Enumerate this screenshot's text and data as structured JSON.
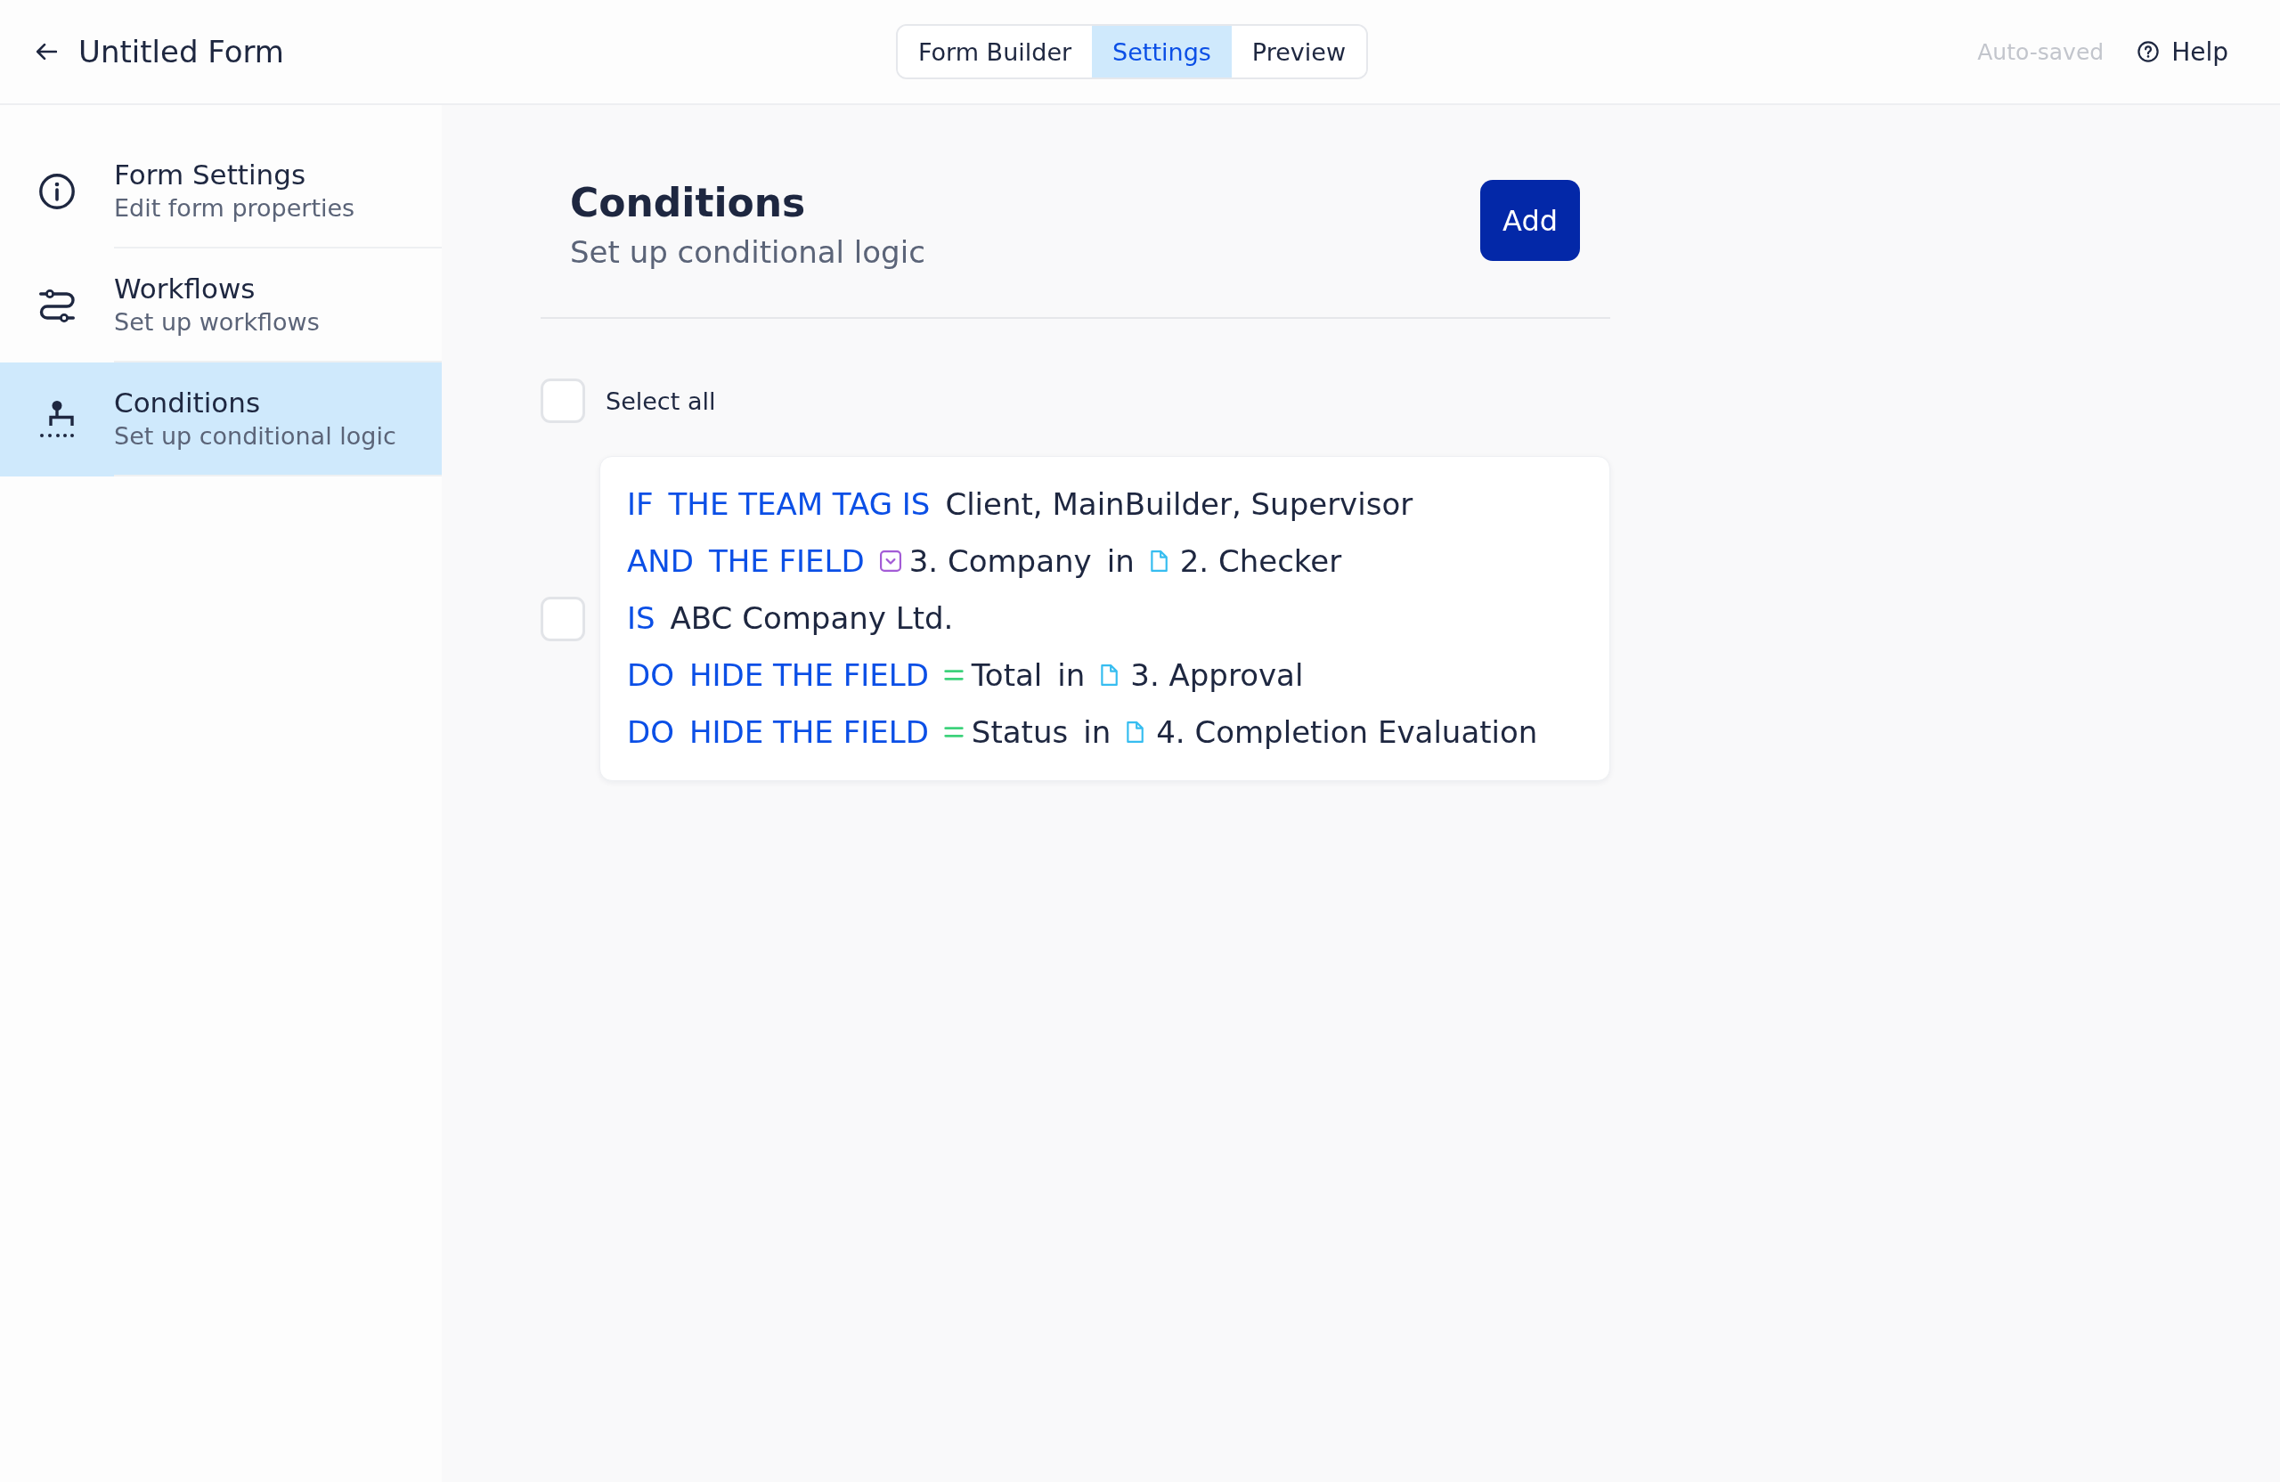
{
  "header": {
    "title": "Untitled Form",
    "tabs": [
      {
        "label": "Form Builder",
        "selected": false
      },
      {
        "label": "Settings",
        "selected": true
      },
      {
        "label": "Preview",
        "selected": false
      }
    ],
    "status": "Auto-saved",
    "help": "Help"
  },
  "sidebar": {
    "items": [
      {
        "title": "Form Settings",
        "description": "Edit form properties",
        "selected": false
      },
      {
        "title": "Workflows",
        "description": "Set up workflows",
        "selected": false
      },
      {
        "title": "Conditions",
        "description": "Set up conditional logic",
        "selected": true
      }
    ]
  },
  "main": {
    "title": "Conditions",
    "subtitle": "Set up conditional logic",
    "add_button": "Add",
    "select_all": {
      "label": "Select all",
      "checked": false
    },
    "conditions": [
      {
        "checked": false,
        "lines": [
          {
            "parts": [
              {
                "kind": "keyword",
                "text": "IF"
              },
              {
                "kind": "keyword",
                "text": "THE TEAM TAG IS"
              },
              {
                "kind": "value",
                "text": "Client, MainBuilder, Supervisor"
              }
            ]
          },
          {
            "parts": [
              {
                "kind": "keyword",
                "text": "AND"
              },
              {
                "kind": "keyword",
                "text": "THE FIELD"
              },
              {
                "kind": "dropdown",
                "text": "3. Company"
              },
              {
                "kind": "connector",
                "text": "in"
              },
              {
                "kind": "page",
                "text": "2. Checker"
              }
            ]
          },
          {
            "parts": [
              {
                "kind": "keyword",
                "text": "IS"
              },
              {
                "kind": "value",
                "text": "ABC Company Ltd."
              }
            ]
          },
          {
            "parts": [
              {
                "kind": "keyword",
                "text": "DO"
              },
              {
                "kind": "keyword",
                "text": "HIDE THE FIELD"
              },
              {
                "kind": "textfield",
                "text": "Total"
              },
              {
                "kind": "connector",
                "text": "in"
              },
              {
                "kind": "page",
                "text": "3. Approval"
              }
            ]
          },
          {
            "parts": [
              {
                "kind": "keyword",
                "text": "DO"
              },
              {
                "kind": "keyword",
                "text": "HIDE THE FIELD"
              },
              {
                "kind": "textfield",
                "text": "Status"
              },
              {
                "kind": "connector",
                "text": "in"
              },
              {
                "kind": "page",
                "text": "4. Completion Evaluation"
              }
            ]
          }
        ]
      }
    ]
  }
}
